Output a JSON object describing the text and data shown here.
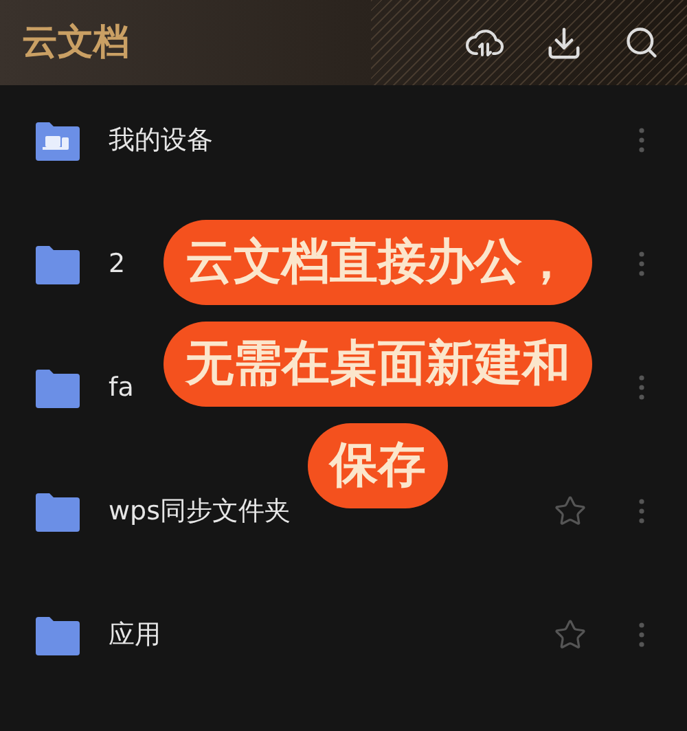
{
  "header": {
    "title": "云文档"
  },
  "rows": [
    {
      "kind": "device",
      "name": "我的设备"
    },
    {
      "kind": "folder",
      "name": "2"
    },
    {
      "kind": "folder",
      "name": "fa"
    },
    {
      "kind": "folder",
      "name": "wps同步文件夹",
      "starred": false
    },
    {
      "kind": "folder",
      "name": "应用",
      "starred": false
    }
  ],
  "caption": {
    "lines": [
      "云文档直接办公，",
      "无需在桌面新建和",
      "保存"
    ]
  }
}
